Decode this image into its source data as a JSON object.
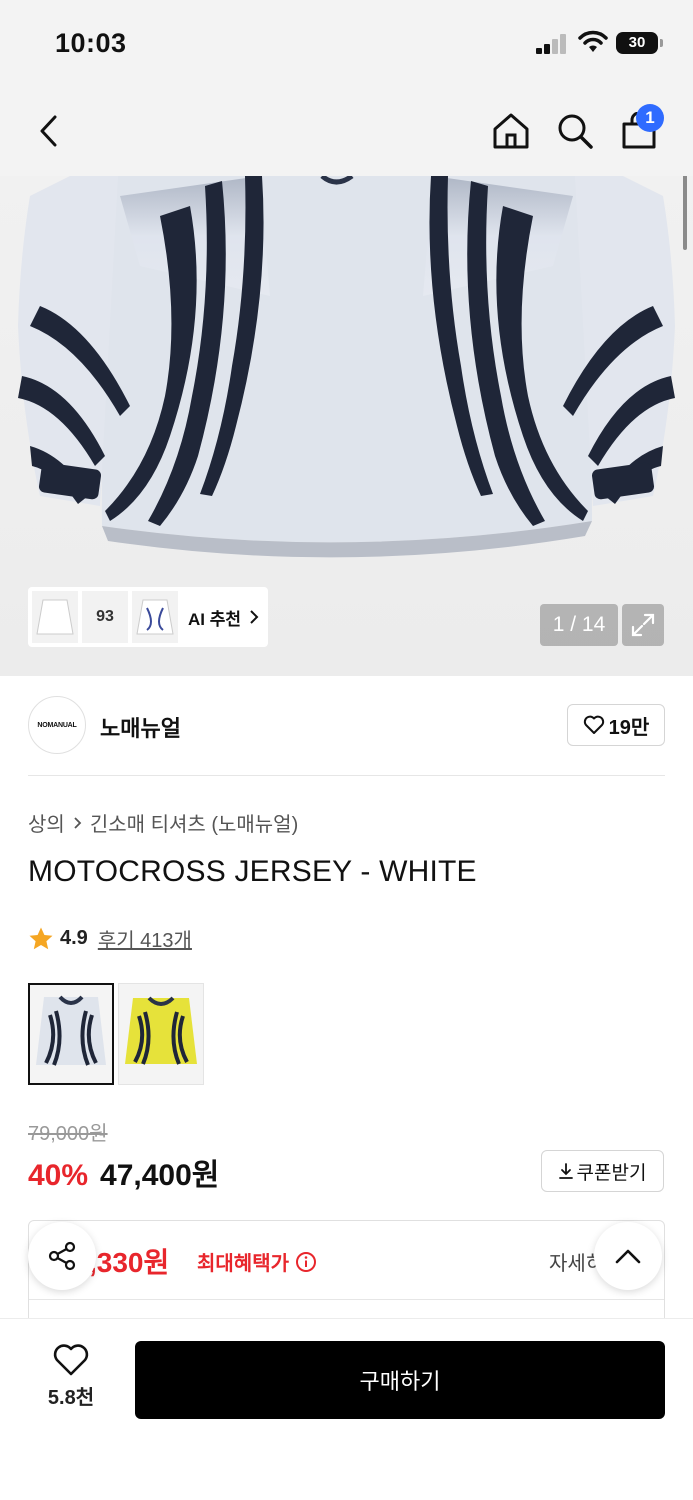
{
  "status_bar": {
    "time": "10:03",
    "battery": "30"
  },
  "header": {
    "cart_count": "1"
  },
  "gallery": {
    "ai_thumb_2_text": "93",
    "ai_label": "AI 추천",
    "page_counter": "1 / 14"
  },
  "brand": {
    "logo_text": "NOMANUAL",
    "name": "노매뉴얼",
    "likes": "19만"
  },
  "category": {
    "level1": "상의",
    "level2": "긴소매 티셔츠 (노매뉴얼)"
  },
  "product": {
    "title": "MOTOCROSS JERSEY - WHITE",
    "rating": "4.9",
    "reviews": "후기 413개",
    "original_price": "79,000원",
    "discount": "40%",
    "sale_price": "47,400원",
    "coupon_label": "쿠폰받기"
  },
  "benefit": {
    "price": ",330원",
    "label": "최대혜택가",
    "detail": "자세히"
  },
  "bottom_bar": {
    "wish_count": "5.8천",
    "buy_label": "구매하기"
  },
  "colors": {
    "accent_red": "#e8262c",
    "badge_blue": "#2f6bff",
    "star": "#f5a623"
  },
  "icons": [
    "back-icon",
    "home-icon",
    "search-icon",
    "cart-icon",
    "chevron-right-icon",
    "expand-icon",
    "heart-icon",
    "star-icon",
    "download-icon",
    "info-icon",
    "share-icon",
    "chevron-up-icon"
  ]
}
